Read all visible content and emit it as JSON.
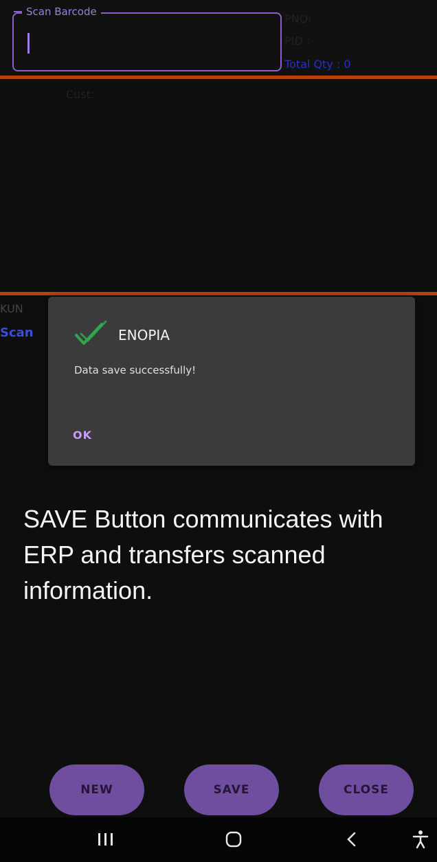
{
  "scan": {
    "legend": "Scan Barcode",
    "value": ""
  },
  "info": {
    "pno": "PNO:",
    "pid": "PID  :",
    "total_qty": "Total Qty  : 0"
  },
  "cust_label": "Cust:",
  "kun_fragment": "KUN",
  "scan_fragment": "Scan",
  "dialog": {
    "title": "ENOPIA",
    "message": "Data save successfully!",
    "ok_label": "OK",
    "icon": "double-check-icon",
    "icon_color": "#2fa84f"
  },
  "caption": "SAVE Button communicates with ERP and transfers scanned information.",
  "buttons": {
    "new": "NEW",
    "save": "SAVE",
    "close": "CLOSE"
  },
  "nav": {
    "recents_icon": "recents-icon",
    "home_icon": "home-icon",
    "back_icon": "back-icon",
    "accessibility_icon": "accessibility-icon"
  },
  "colors": {
    "accent_purple": "#6f4e9f",
    "divider_orange": "#b8420d",
    "total_qty_blue": "#2630c4"
  }
}
